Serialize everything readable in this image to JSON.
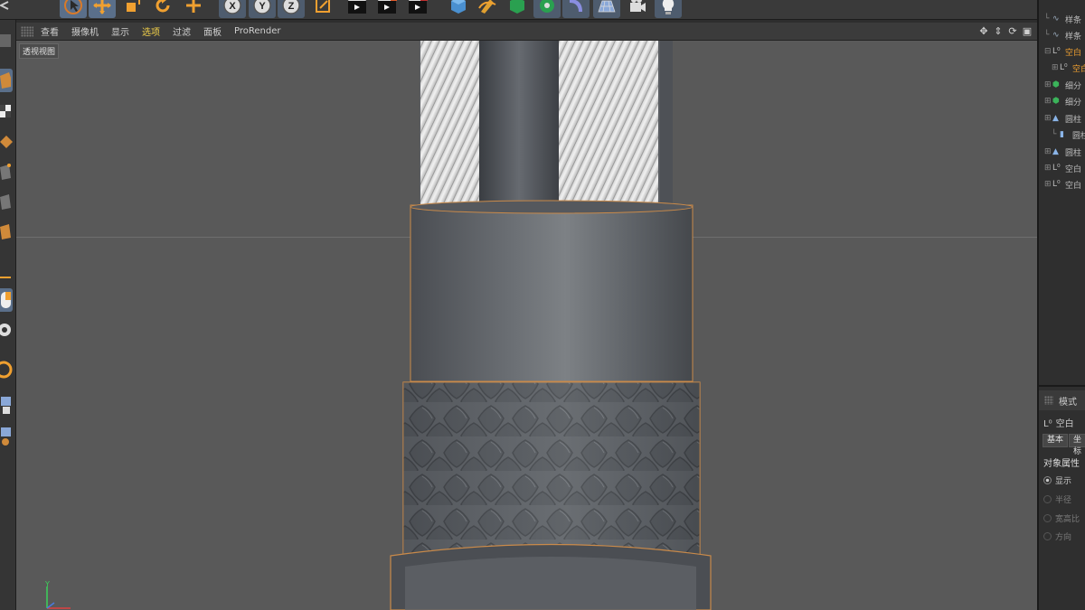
{
  "viewport_menu": {
    "items": [
      "查看",
      "摄像机",
      "显示",
      "选项",
      "过滤",
      "面板",
      "ProRender"
    ],
    "active_index": 3
  },
  "viewport": {
    "label": "透视视图",
    "axis": {
      "y": "Y",
      "x": "X"
    }
  },
  "object_manager": {
    "items": [
      {
        "name": "样条",
        "icon": "spline-icon"
      },
      {
        "name": "样条",
        "icon": "spline-icon"
      },
      {
        "name": "空白",
        "icon": "null-icon"
      },
      {
        "name": "空白",
        "icon": "null-icon"
      },
      {
        "name": "细分",
        "icon": "subdivision-icon"
      },
      {
        "name": "细分",
        "icon": "subdivision-icon"
      },
      {
        "name": "圆柱",
        "icon": "cylinder-icon"
      },
      {
        "name": "圆柱",
        "icon": "cylinder-icon"
      },
      {
        "name": "圆柱",
        "icon": "cylinder-icon"
      },
      {
        "name": "空白",
        "icon": "null-icon"
      },
      {
        "name": "空白",
        "icon": "null-icon"
      }
    ]
  },
  "attributes": {
    "header": "模式",
    "object_name": "空白",
    "tabs": [
      "基本",
      "坐标"
    ],
    "section": "对象属性",
    "fields": [
      {
        "label": "显示",
        "enabled": true
      },
      {
        "label": "半径",
        "enabled": false
      },
      {
        "label": "宽高比",
        "enabled": false
      },
      {
        "label": "方向",
        "enabled": false
      }
    ]
  },
  "colors": {
    "accent_selected": "#5a6f8a",
    "active_menu": "#f4d24a",
    "viewport_bg": "#595959",
    "cable_body": "#5f6368",
    "cable_highlight": "#7d8185"
  }
}
